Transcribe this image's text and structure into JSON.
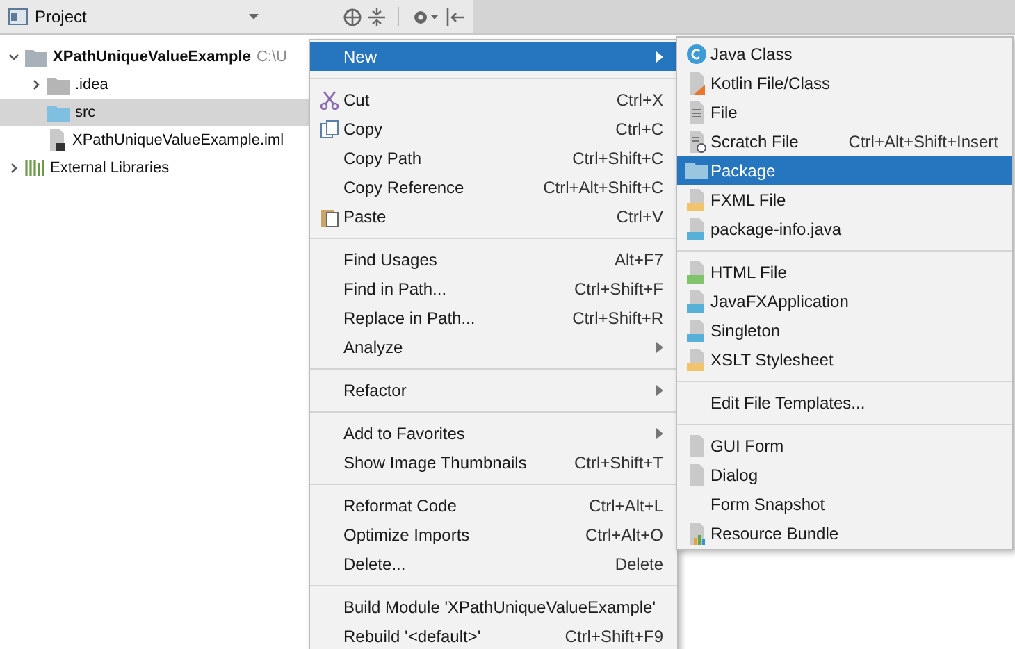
{
  "panel": {
    "title": "Project"
  },
  "tree": [
    {
      "label": "XPathUniqueValueExample",
      "path": "C:\\U",
      "expanded": true,
      "selected": false,
      "children": [
        {
          "label": ".idea",
          "expanded": false,
          "selected": false,
          "kind": "folder"
        },
        {
          "label": "src",
          "selected": true,
          "kind": "source"
        },
        {
          "label": "XPathUniqueValueExample.iml",
          "selected": false,
          "kind": "file"
        }
      ],
      "kind": "module"
    },
    {
      "label": "External Libraries",
      "expanded": false,
      "selected": false,
      "kind": "library"
    }
  ],
  "context_menu": {
    "items": [
      {
        "kind": "item",
        "label": "New",
        "selected": true,
        "has_submenu": true
      },
      {
        "kind": "separator"
      },
      {
        "kind": "item",
        "label": "Cut",
        "shortcut": "Ctrl+X",
        "selected": false,
        "has_submenu": false
      },
      {
        "kind": "item",
        "label": "Copy",
        "shortcut": "Ctrl+C",
        "selected": false,
        "has_submenu": false
      },
      {
        "kind": "item",
        "label": "Copy Path",
        "shortcut": "Ctrl+Shift+C",
        "selected": false,
        "has_submenu": false
      },
      {
        "kind": "item",
        "label": "Copy Reference",
        "shortcut": "Ctrl+Alt+Shift+C",
        "selected": false,
        "has_submenu": false
      },
      {
        "kind": "item",
        "label": "Paste",
        "shortcut": "Ctrl+V",
        "selected": false,
        "has_submenu": false
      },
      {
        "kind": "separator"
      },
      {
        "kind": "item",
        "label": "Find Usages",
        "shortcut": "Alt+F7",
        "selected": false,
        "has_submenu": false
      },
      {
        "kind": "item",
        "label": "Find in Path...",
        "shortcut": "Ctrl+Shift+F",
        "selected": false,
        "has_submenu": false
      },
      {
        "kind": "item",
        "label": "Replace in Path...",
        "shortcut": "Ctrl+Shift+R",
        "selected": false,
        "has_submenu": false
      },
      {
        "kind": "item",
        "label": "Analyze",
        "selected": false,
        "has_submenu": true
      },
      {
        "kind": "separator"
      },
      {
        "kind": "item",
        "label": "Refactor",
        "selected": false,
        "has_submenu": true
      },
      {
        "kind": "separator"
      },
      {
        "kind": "item",
        "label": "Add to Favorites",
        "selected": false,
        "has_submenu": true
      },
      {
        "kind": "item",
        "label": "Show Image Thumbnails",
        "shortcut": "Ctrl+Shift+T",
        "selected": false,
        "has_submenu": false
      },
      {
        "kind": "separator"
      },
      {
        "kind": "item",
        "label": "Reformat Code",
        "shortcut": "Ctrl+Alt+L",
        "selected": false,
        "has_submenu": false
      },
      {
        "kind": "item",
        "label": "Optimize Imports",
        "shortcut": "Ctrl+Alt+O",
        "selected": false,
        "has_submenu": false
      },
      {
        "kind": "item",
        "label": "Delete...",
        "shortcut": "Delete",
        "selected": false,
        "has_submenu": false
      },
      {
        "kind": "separator"
      },
      {
        "kind": "item",
        "label": "Build Module 'XPathUniqueValueExample'",
        "selected": false,
        "has_submenu": false
      },
      {
        "kind": "item",
        "label": "Rebuild '<default>'",
        "shortcut": "Ctrl+Shift+F9",
        "selected": false,
        "has_submenu": false
      }
    ]
  },
  "new_submenu": {
    "items": [
      {
        "kind": "item",
        "label": "Java Class",
        "selected": false
      },
      {
        "kind": "item",
        "label": "Kotlin File/Class",
        "selected": false
      },
      {
        "kind": "item",
        "label": "File",
        "selected": false
      },
      {
        "kind": "item",
        "label": "Scratch File",
        "shortcut": "Ctrl+Alt+Shift+Insert",
        "selected": false
      },
      {
        "kind": "item",
        "label": "Package",
        "selected": true
      },
      {
        "kind": "item",
        "label": "FXML File",
        "selected": false
      },
      {
        "kind": "item",
        "label": "package-info.java",
        "selected": false
      },
      {
        "kind": "separator"
      },
      {
        "kind": "item",
        "label": "HTML File",
        "selected": false
      },
      {
        "kind": "item",
        "label": "JavaFXApplication",
        "selected": false
      },
      {
        "kind": "item",
        "label": "Singleton",
        "selected": false
      },
      {
        "kind": "item",
        "label": "XSLT Stylesheet",
        "selected": false
      },
      {
        "kind": "separator"
      },
      {
        "kind": "item",
        "label": "Edit File Templates...",
        "selected": false
      },
      {
        "kind": "separator"
      },
      {
        "kind": "item",
        "label": "GUI Form",
        "selected": false
      },
      {
        "kind": "item",
        "label": "Dialog",
        "selected": false
      },
      {
        "kind": "item",
        "label": "Form Snapshot",
        "selected": false
      },
      {
        "kind": "item",
        "label": "Resource Bundle",
        "selected": false
      }
    ]
  }
}
